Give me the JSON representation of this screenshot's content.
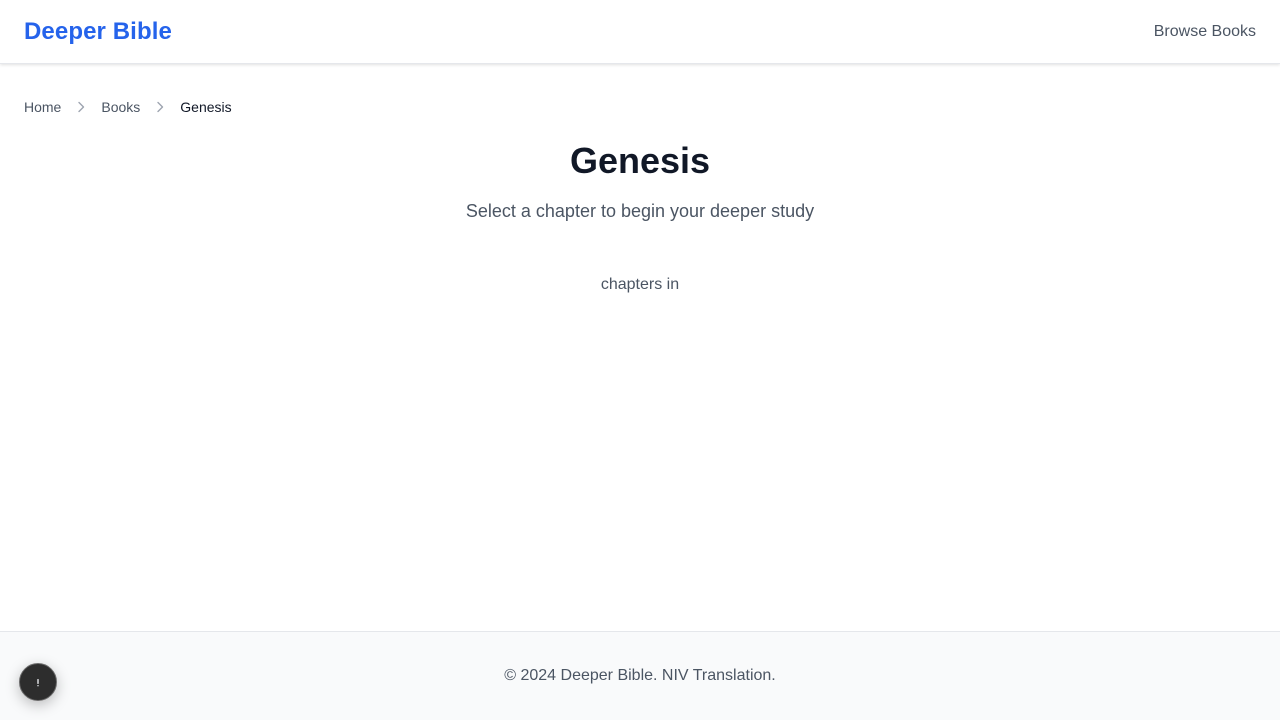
{
  "header": {
    "brand": "Deeper Bible",
    "nav_browse": "Browse Books"
  },
  "breadcrumb": {
    "home": "Home",
    "books": "Books",
    "current": "Genesis"
  },
  "main": {
    "title": "Genesis",
    "subtitle": "Select a chapter to begin your deeper study",
    "count_text": "chapters in"
  },
  "footer": {
    "text": "© 2024 Deeper Bible. NIV Translation."
  },
  "icons": {
    "breadcrumb_separator": "chevron-right-icon",
    "floating_button": "info-icon"
  },
  "colors": {
    "brand": "#2563eb",
    "heading": "#111827",
    "muted": "#4b5563",
    "footer_bg": "#f9fafb"
  }
}
